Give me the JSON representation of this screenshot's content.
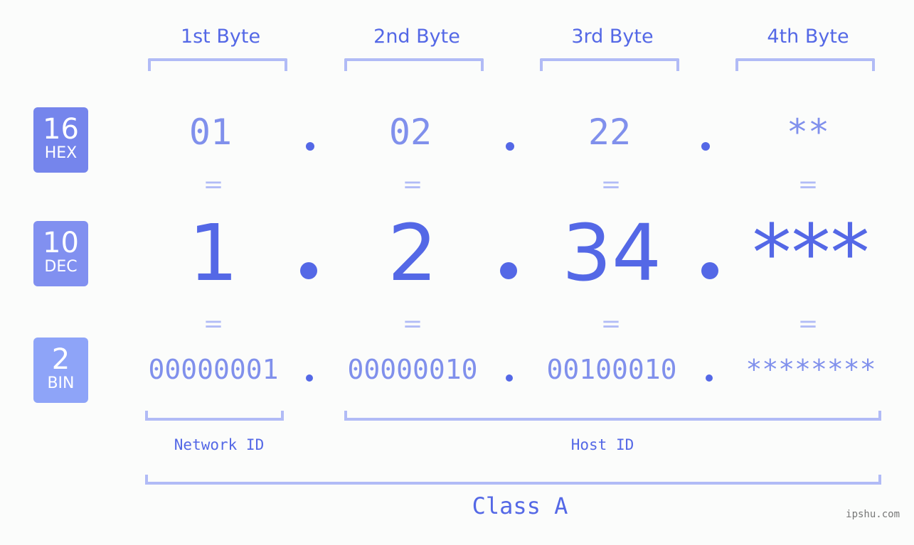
{
  "bytes": [
    {
      "title": "1st Byte",
      "hex": "01",
      "dec": "1",
      "bin": "00000001"
    },
    {
      "title": "2nd Byte",
      "hex": "02",
      "dec": "2",
      "bin": "00000010"
    },
    {
      "title": "3rd Byte",
      "hex": "22",
      "dec": "34",
      "bin": "00100010"
    },
    {
      "title": "4th Byte",
      "hex": "**",
      "dec": "***",
      "bin": "********"
    }
  ],
  "bases": {
    "hex": {
      "number": "16",
      "label": "HEX",
      "color": "#7585ec"
    },
    "dec": {
      "number": "10",
      "label": "DEC",
      "color": "#8190f0"
    },
    "bin": {
      "number": "2",
      "label": "BIN",
      "color": "#8ea4f8"
    }
  },
  "equals_sign": "=",
  "network_id_label": "Network ID",
  "host_id_label": "Host ID",
  "class_label": "Class A",
  "watermark": "ipshu.com",
  "colors": {
    "accent": "#5468e6",
    "light": "#8090ec",
    "bracket": "#b1bbf6"
  }
}
